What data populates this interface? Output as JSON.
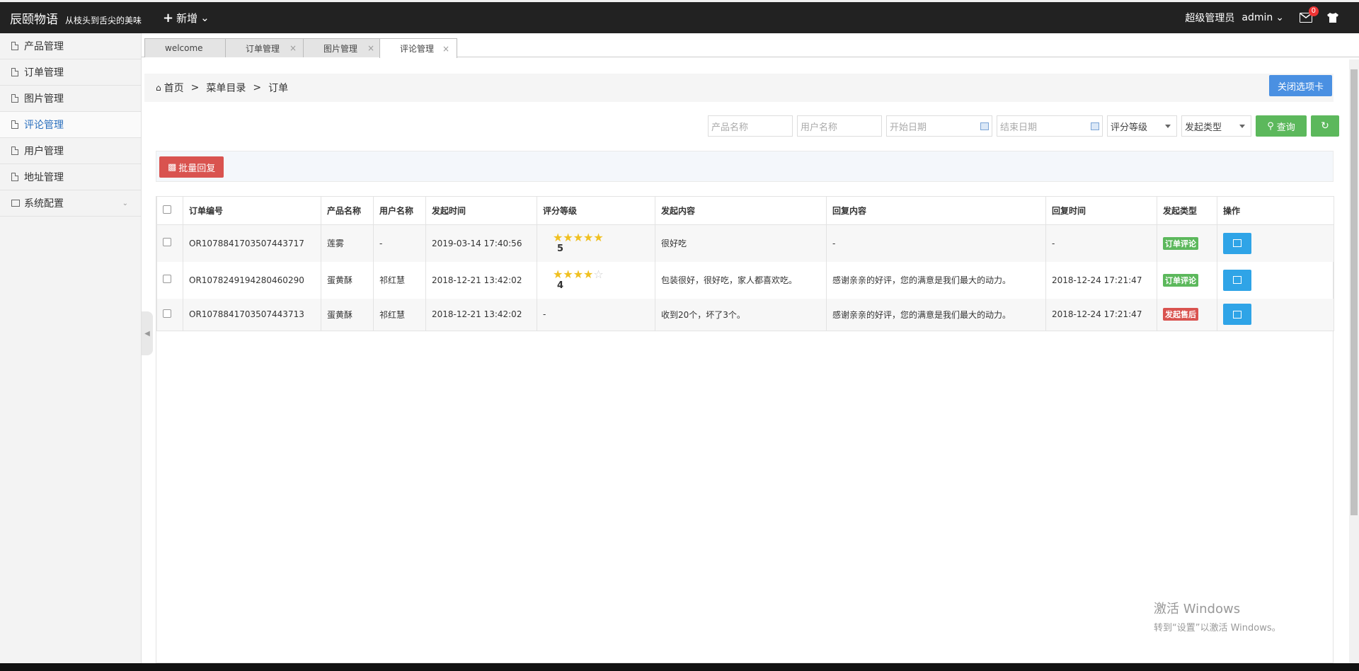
{
  "header": {
    "brand": "辰颐物语",
    "slogan": "从枝头到舌尖的美味",
    "new_label": "新增",
    "role": "超级管理员",
    "username": "admin",
    "mail_badge": "0"
  },
  "sidebar": {
    "items": [
      {
        "label": "产品管理"
      },
      {
        "label": "订单管理"
      },
      {
        "label": "图片管理"
      },
      {
        "label": "评论管理"
      },
      {
        "label": "用户管理"
      },
      {
        "label": "地址管理"
      },
      {
        "label": "系统配置"
      }
    ]
  },
  "tabs": [
    {
      "label": "welcome"
    },
    {
      "label": "订单管理"
    },
    {
      "label": "图片管理"
    },
    {
      "label": "评论管理"
    }
  ],
  "breadcrumb": {
    "home": "首页",
    "level1": "菜单目录",
    "level2": "订单",
    "close_tabs": "关闭选项卡"
  },
  "search": {
    "product_placeholder": "产品名称",
    "user_placeholder": "用户名称",
    "start_placeholder": "开始日期",
    "end_placeholder": "结束日期",
    "rating_select": "评分等级",
    "type_select": "发起类型",
    "query_label": "查询"
  },
  "toolbar": {
    "batch_reply": "批量回复"
  },
  "table": {
    "headers": [
      "订单编号",
      "产品名称",
      "用户名称",
      "发起时间",
      "评分等级",
      "发起内容",
      "回复内容",
      "回复时间",
      "发起类型",
      "操作"
    ],
    "rows": [
      {
        "order": "OR1078841703507443717",
        "product": "莲雾",
        "user": "-",
        "time": "2019-03-14 17:40:56",
        "rating": 5,
        "rating_text": "5",
        "content": "很好吃",
        "reply": "-",
        "reply_time": "-",
        "type": "订单评论"
      },
      {
        "order": "OR1078249194280460290",
        "product": "蛋黄酥",
        "user": "祁红慧",
        "time": "2018-12-21 13:42:02",
        "rating": 4,
        "rating_text": "4",
        "content": "包装很好，很好吃，家人都喜欢吃。",
        "reply": "感谢亲亲的好评，您的满意是我们最大的动力。",
        "reply_time": "2018-12-24 17:21:47",
        "type": "订单评论"
      },
      {
        "order": "OR1078841703507443713",
        "product": "蛋黄酥",
        "user": "祁红慧",
        "time": "2018-12-21 13:42:02",
        "rating": null,
        "rating_text": "-",
        "content": "收到20个，坏了3个。",
        "reply": "感谢亲亲的好评，您的满意是我们最大的动力。",
        "reply_time": "2018-12-24 17:21:47",
        "type": "发起售后"
      }
    ]
  },
  "watermark": {
    "line1": "激活 Windows",
    "line2": "转到“设置”以激活 Windows。"
  },
  "colors": {
    "topbar": "#222222",
    "accent_blue": "#4a90e2",
    "green": "#5cb85c",
    "red": "#d9534f",
    "op_blue": "#2fa4e7",
    "star": "#f0c020"
  }
}
